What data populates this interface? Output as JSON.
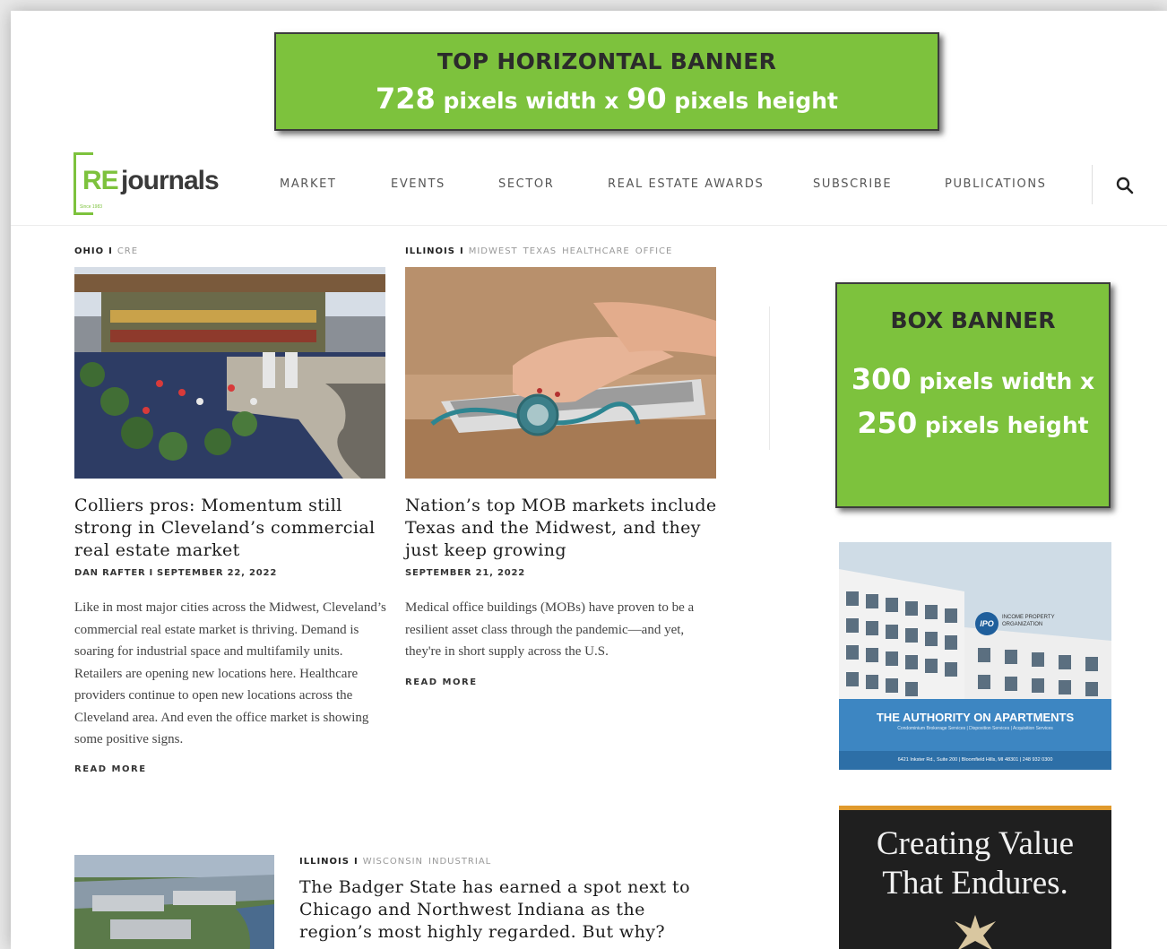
{
  "top_banner": {
    "title": "TOP HORIZONTAL BANNER",
    "width_value": "728",
    "width_text": " pixels width x ",
    "height_value": "90",
    "height_text": " pixels height"
  },
  "header": {
    "logo_re": "RE",
    "logo_journals": "journals",
    "logo_tagline": "Since 1983",
    "nav": [
      "MARKET",
      "EVENTS",
      "SECTOR",
      "REAL ESTATE AWARDS",
      "SUBSCRIBE",
      "PUBLICATIONS"
    ]
  },
  "articles": [
    {
      "category": "OHIO",
      "tags": [
        "CRE"
      ],
      "headline": "Colliers pros: Momentum still strong in Cleveland’s commercial real estate market",
      "author": "DAN RAFTER",
      "date": "SEPTEMBER 22, 2022",
      "excerpt": "Like in most major cities across the Midwest, Cleveland’s commercial real estate market is thriving. Demand is soaring for industrial space and multifamily units. Retailers are opening new locations here. Healthcare providers continue to open new locations across the Cleveland area. And even the office market is showing some positive signs.",
      "read_more": "READ MORE"
    },
    {
      "category": "ILLINOIS",
      "tags": [
        "MIDWEST",
        "TEXAS",
        "HEALTHCARE",
        "OFFICE"
      ],
      "headline": "Nation’s top MOB markets include Texas and the Midwest, and they just keep growing",
      "date": "SEPTEMBER 21, 2022",
      "excerpt": "Medical office buildings (MOBs) have proven to be a resilient asset class through the pandemic—and yet, they're in short supply across the U.S.",
      "read_more": "READ MORE"
    },
    {
      "category": "ILLINOIS",
      "tags": [
        "WISCONSIN",
        "INDUSTRIAL"
      ],
      "headline": "The Badger State has earned a spot next to Chicago and Northwest Indiana as the region’s most highly regarded. But why?"
    }
  ],
  "box_banner": {
    "title": "BOX BANNER",
    "width_value": "300",
    "width_text": " pixels width x",
    "height_value": "250",
    "height_text": " pixels height"
  },
  "ads": {
    "ipo": {
      "logo": "IPO",
      "name": "INCOME PROPERTY ORGANIZATION",
      "title": "THE AUTHORITY ON APARTMENTS",
      "subtitle": "Condominium Brokerage Services | Disposition Services | Acquisition Services",
      "address": "6421 Inkster Rd., Suite 200 | Bloomfield Hills, MI 48301 | 248 932 0300"
    },
    "creating_value": {
      "line1": "Creating Value",
      "line2": "That Endures."
    }
  },
  "colors": {
    "banner_green": "#7dc23d",
    "logo_green": "#7dc23d",
    "ipo_blue": "#3d86c2",
    "ad_dark": "#1f1f1f",
    "ad_accent": "#e09a2c"
  }
}
